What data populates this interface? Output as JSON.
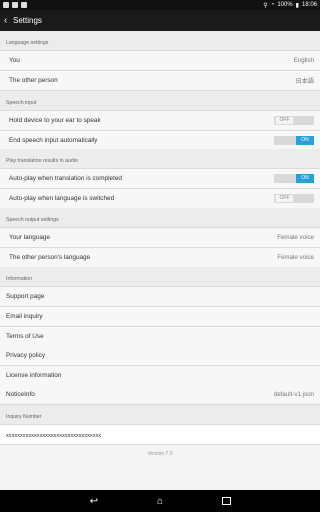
{
  "status": {
    "battery": "100%",
    "time": "18:06"
  },
  "appbar": {
    "title": "Settings"
  },
  "sections": {
    "language": {
      "header": "Language settings",
      "you_label": "You",
      "you_value": "English",
      "other_label": "The other person",
      "other_value": "日本語"
    },
    "speech_input": {
      "header": "Speech input",
      "hold_label": "Hold device to your ear to speak",
      "hold_state": "OFF",
      "end_label": "End speech input automatically",
      "end_state": "ON"
    },
    "audio": {
      "header": "Play translation results in audio",
      "autoplay_complete_label": "Auto-play when translation is completed",
      "autoplay_complete_state": "ON",
      "autoplay_switch_label": "Auto-play when language is switched",
      "autoplay_switch_state": "OFF"
    },
    "speech_output": {
      "header": "Speech output settings",
      "your_lang_label": "Your language",
      "your_lang_value": "Female voice",
      "other_lang_label": "The other person's language",
      "other_lang_value": "Female voice"
    },
    "information": {
      "header": "Information",
      "support": "Support page",
      "email": "Email inquiry",
      "terms": "Terms of Use",
      "privacy": "Privacy policy",
      "license": "License information",
      "notice_label": "NoticeInfo",
      "notice_value": "default-v1.json"
    },
    "inquiry": {
      "header": "Inquiry Number",
      "number": "xxxxxxxxxxxxxxxxxxxxxxxxxxxxxxxxxx"
    }
  },
  "version": "Version 7.0",
  "colors": {
    "accent": "#2a9fd8"
  },
  "icons": {
    "back": "chevron-left-icon",
    "nav_back": "back-arrow-icon",
    "nav_home": "home-icon",
    "nav_recent": "recent-apps-icon"
  }
}
